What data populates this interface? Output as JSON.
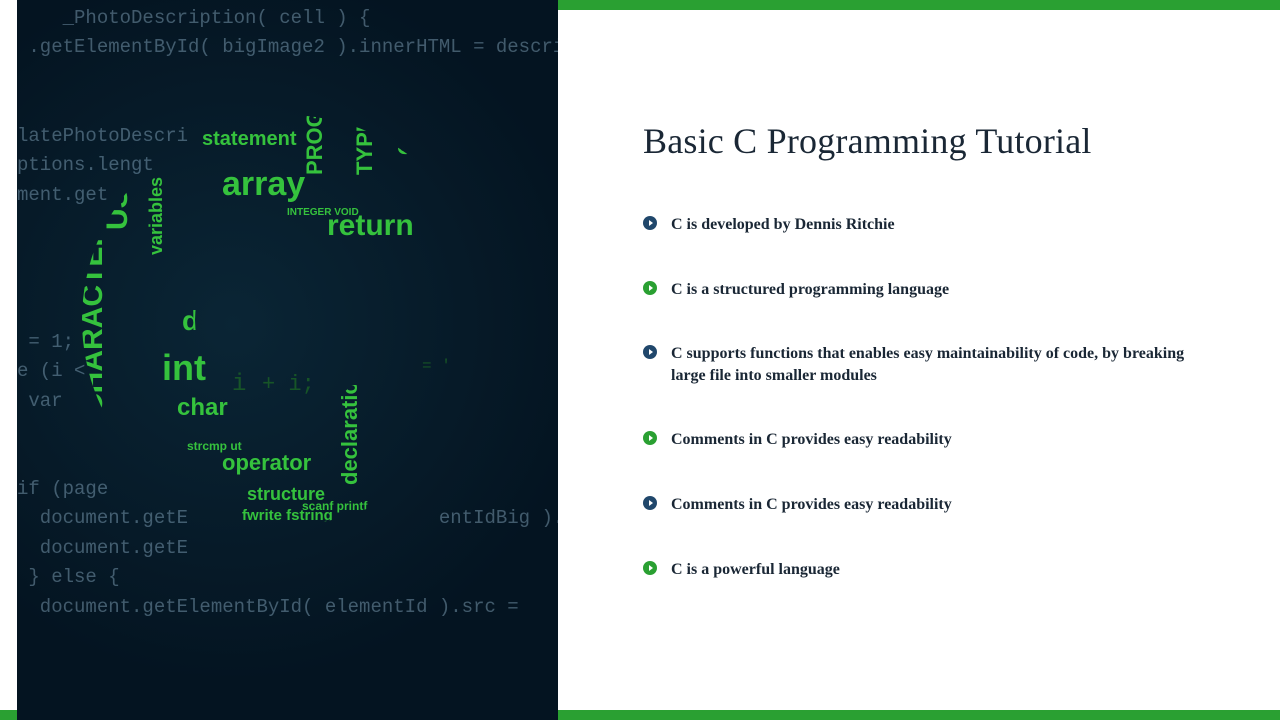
{
  "title": "Basic C Programming Tutorial",
  "bullets": [
    {
      "color": "blue",
      "text": "C is developed by Dennis Ritchie"
    },
    {
      "color": "green",
      "text": "C is a structured programming language"
    },
    {
      "color": "blue",
      "text": "C supports functions that enables easy maintainability of code, by breaking large file into smaller modules"
    },
    {
      "color": "green",
      "text": "Comments in C provides easy readability"
    },
    {
      "color": "blue",
      "text": "Comments in C provides easy readability"
    },
    {
      "color": "green",
      "text": "C is a powerful language"
    }
  ],
  "code_bg": "    _PhotoDescription( cell ) {\n .getElementById( bigImage2 ).innerHTML = description\n\n\nlatePhotoDescri\nptions.lengt\nment.get\n\n\n\n\n = 1;\ne (i <\n var\n\n\nif (page\n  document.getE                      entIdBig ).src = '\n  document.getE\n } else {\n  document.getElementById( elementId ).src ="
}
